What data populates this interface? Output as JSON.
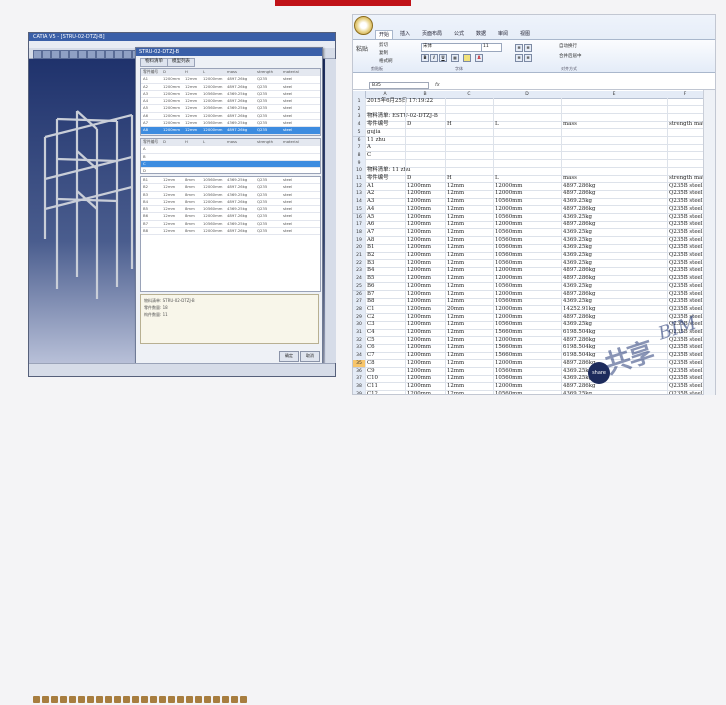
{
  "cad": {
    "window_title": "CATIA V5 - [STRU-02-DTZJ-B]",
    "dialog": {
      "title": "STRU-02-DTZJ-B",
      "tabs": [
        "物料清单",
        "模型列表"
      ],
      "grid1": {
        "headers": [
          "零件编号",
          "D",
          "H",
          "L",
          "mass",
          "strength",
          "material"
        ],
        "rows": [
          [
            "A1",
            "1200mm",
            "12mm",
            "12000mm",
            "4897.26kg",
            "Q235",
            "steel"
          ],
          [
            "A2",
            "1200mm",
            "12mm",
            "12000mm",
            "4897.26kg",
            "Q235",
            "steel"
          ],
          [
            "A3",
            "1200mm",
            "12mm",
            "10560mm",
            "4369.25kg",
            "Q235",
            "steel"
          ],
          [
            "A4",
            "1200mm",
            "12mm",
            "12000mm",
            "4897.26kg",
            "Q235",
            "steel"
          ],
          [
            "A5",
            "1200mm",
            "12mm",
            "10560mm",
            "4369.25kg",
            "Q235",
            "steel"
          ],
          [
            "A6",
            "1200mm",
            "12mm",
            "12000mm",
            "4897.26kg",
            "Q235",
            "steel"
          ],
          [
            "A7",
            "1200mm",
            "12mm",
            "10560mm",
            "4369.25kg",
            "Q235",
            "steel"
          ],
          [
            "A8",
            "1200mm",
            "12mm",
            "12000mm",
            "4897.26kg",
            "Q235",
            "steel"
          ]
        ],
        "selected_row": 7
      },
      "grid2": {
        "headers": [
          "零件编号",
          "D",
          "H",
          "L",
          "mass",
          "strength",
          "material"
        ],
        "rows": [
          [
            "A"
          ],
          [
            "B"
          ],
          [
            "C"
          ],
          [
            "D"
          ]
        ],
        "selected_row": 2
      },
      "grid3": {
        "rows": [
          [
            "B1",
            "12mm",
            "8mm",
            "10560mm",
            "4369.25kg",
            "Q235",
            "steel"
          ],
          [
            "B2",
            "12mm",
            "8mm",
            "12000mm",
            "4897.26kg",
            "Q235",
            "steel"
          ],
          [
            "B3",
            "12mm",
            "8mm",
            "10560mm",
            "4369.25kg",
            "Q235",
            "steel"
          ],
          [
            "B4",
            "12mm",
            "8mm",
            "12000mm",
            "4897.26kg",
            "Q235",
            "steel"
          ],
          [
            "B5",
            "12mm",
            "8mm",
            "10560mm",
            "4369.25kg",
            "Q235",
            "steel"
          ],
          [
            "B6",
            "12mm",
            "8mm",
            "12000mm",
            "4897.26kg",
            "Q235",
            "steel"
          ],
          [
            "B7",
            "12mm",
            "8mm",
            "10560mm",
            "4369.25kg",
            "Q235",
            "steel"
          ],
          [
            "B8",
            "12mm",
            "8mm",
            "12000mm",
            "4897.26kg",
            "Q235",
            "steel"
          ]
        ]
      },
      "info_lines": [
        "物料清单: STRU-02-DTZJ-B",
        "零件数量: 18",
        "构件数量: 11"
      ],
      "buttons": [
        "确定",
        "取消"
      ]
    }
  },
  "excel": {
    "tabs": [
      "开始",
      "插入",
      "页面布局",
      "公式",
      "数据",
      "审阅",
      "视图"
    ],
    "active_tab": "开始",
    "clipboard": {
      "paste": "粘贴",
      "cut": "剪切",
      "copy": "复制",
      "format_painter": "格式刷",
      "group": "剪贴板"
    },
    "font": {
      "name": "宋体",
      "size": "11",
      "group": "字体"
    },
    "alignment_group": "对齐方式",
    "wrap_text": "自动换行",
    "merge_center": "合并后居中",
    "name_box": "B35",
    "columns": [
      "A",
      "B",
      "C",
      "D",
      "E",
      "F",
      "G"
    ],
    "rows": [
      [
        "1",
        "2015年6月25日 17:19:22",
        "",
        "",
        "",
        "",
        ""
      ],
      [
        "2",
        "",
        "",
        "",
        "",
        "",
        ""
      ],
      [
        "3",
        "物料清单: ESTU-02-DTZJ-B",
        "",
        "",
        "",
        "",
        ""
      ],
      [
        "4",
        "零件编号",
        "D",
        "H",
        "L",
        "mass",
        "strength material"
      ],
      [
        "5",
        "gujia",
        "",
        "",
        "",
        "",
        ""
      ],
      [
        "6",
        "11 zhu",
        "",
        "",
        "",
        "",
        ""
      ],
      [
        "7",
        "A",
        "",
        "",
        "",
        "",
        ""
      ],
      [
        "8",
        "C",
        "",
        "",
        "",
        "",
        ""
      ],
      [
        "9",
        "",
        "",
        "",
        "",
        "",
        ""
      ],
      [
        "10",
        "物料清单: 11 zhu",
        "",
        "",
        "",
        "",
        ""
      ],
      [
        "11",
        "零件编号",
        "D",
        "H",
        "L",
        "mass",
        "strength material"
      ],
      [
        "12",
        "A1",
        "1200mm",
        "12mm",
        "12000mm",
        "4897.286kg",
        "Q235B steel"
      ],
      [
        "13",
        "A2",
        "1200mm",
        "12mm",
        "12000mm",
        "4897.286kg",
        "Q235B steel"
      ],
      [
        "14",
        "A3",
        "1200mm",
        "12mm",
        "10560mm",
        "4369.25kg",
        "Q235B steel"
      ],
      [
        "15",
        "A4",
        "1200mm",
        "12mm",
        "12000mm",
        "4897.286kg",
        "Q235B steel"
      ],
      [
        "16",
        "A5",
        "1200mm",
        "12mm",
        "10560mm",
        "4369.25kg",
        "Q235B steel"
      ],
      [
        "17",
        "A6",
        "1200mm",
        "12mm",
        "12000mm",
        "4897.286kg",
        "Q235B steel"
      ],
      [
        "18",
        "A7",
        "1200mm",
        "12mm",
        "10560mm",
        "4369.25kg",
        "Q235B steel"
      ],
      [
        "19",
        "A8",
        "1200mm",
        "12mm",
        "10560mm",
        "4369.25kg",
        "Q235B steel"
      ],
      [
        "20",
        "B1",
        "1200mm",
        "12mm",
        "10560mm",
        "4369.25kg",
        "Q235B steel"
      ],
      [
        "21",
        "B2",
        "1200mm",
        "12mm",
        "10560mm",
        "4369.25kg",
        "Q235B steel"
      ],
      [
        "22",
        "B3",
        "1200mm",
        "12mm",
        "10560mm",
        "4369.25kg",
        "Q235B steel"
      ],
      [
        "23",
        "B4",
        "1200mm",
        "12mm",
        "12000mm",
        "4897.286kg",
        "Q235B steel"
      ],
      [
        "24",
        "B5",
        "1200mm",
        "12mm",
        "12000mm",
        "4897.286kg",
        "Q235B steel"
      ],
      [
        "25",
        "B6",
        "1200mm",
        "12mm",
        "10560mm",
        "4369.25kg",
        "Q235B steel"
      ],
      [
        "26",
        "B7",
        "1200mm",
        "12mm",
        "12000mm",
        "4897.286kg",
        "Q235B steel"
      ],
      [
        "27",
        "B8",
        "1200mm",
        "12mm",
        "10560mm",
        "4369.25kg",
        "Q235B steel"
      ],
      [
        "28",
        "C1",
        "1200mm",
        "20mm",
        "12000mm",
        "14252.91kg",
        "Q235B steel"
      ],
      [
        "29",
        "C2",
        "1200mm",
        "12mm",
        "12000mm",
        "4897.286kg",
        "Q235B steel"
      ],
      [
        "30",
        "C3",
        "1200mm",
        "12mm",
        "10560mm",
        "4369.25kg",
        "Q235B steel"
      ],
      [
        "31",
        "C4",
        "1200mm",
        "12mm",
        "15660mm",
        "6198.504kg",
        "Q235B steel"
      ],
      [
        "32",
        "C5",
        "1200mm",
        "12mm",
        "12000mm",
        "4897.286kg",
        "Q235B steel"
      ],
      [
        "33",
        "C6",
        "1200mm",
        "12mm",
        "15660mm",
        "6198.504kg",
        "Q235B steel"
      ],
      [
        "34",
        "C7",
        "1200mm",
        "12mm",
        "15660mm",
        "6198.504kg",
        "Q235B steel"
      ],
      [
        "35",
        "C8",
        "1200mm",
        "12mm",
        "12000mm",
        "4897.286kg",
        "Q235B steel"
      ],
      [
        "36",
        "C9",
        "1200mm",
        "12mm",
        "10560mm",
        "4369.25kg",
        "Q235B steel"
      ],
      [
        "37",
        "C10",
        "1200mm",
        "12mm",
        "10560mm",
        "4369.25kg",
        "Q235B steel"
      ],
      [
        "38",
        "C11",
        "1200mm",
        "12mm",
        "12000mm",
        "4897.286kg",
        "Q235B steel"
      ],
      [
        "39",
        "C12",
        "1200mm",
        "12mm",
        "10560mm",
        "4369.25kg",
        "Q235B steel"
      ]
    ],
    "selected_row": "35"
  },
  "watermark": {
    "cn": "共享",
    "en": "BIM",
    "badge": "share"
  },
  "colors": {
    "accent_red": "#c01218",
    "cad_blue": "#1c2f66",
    "selection_blue": "#3d8ce0"
  }
}
